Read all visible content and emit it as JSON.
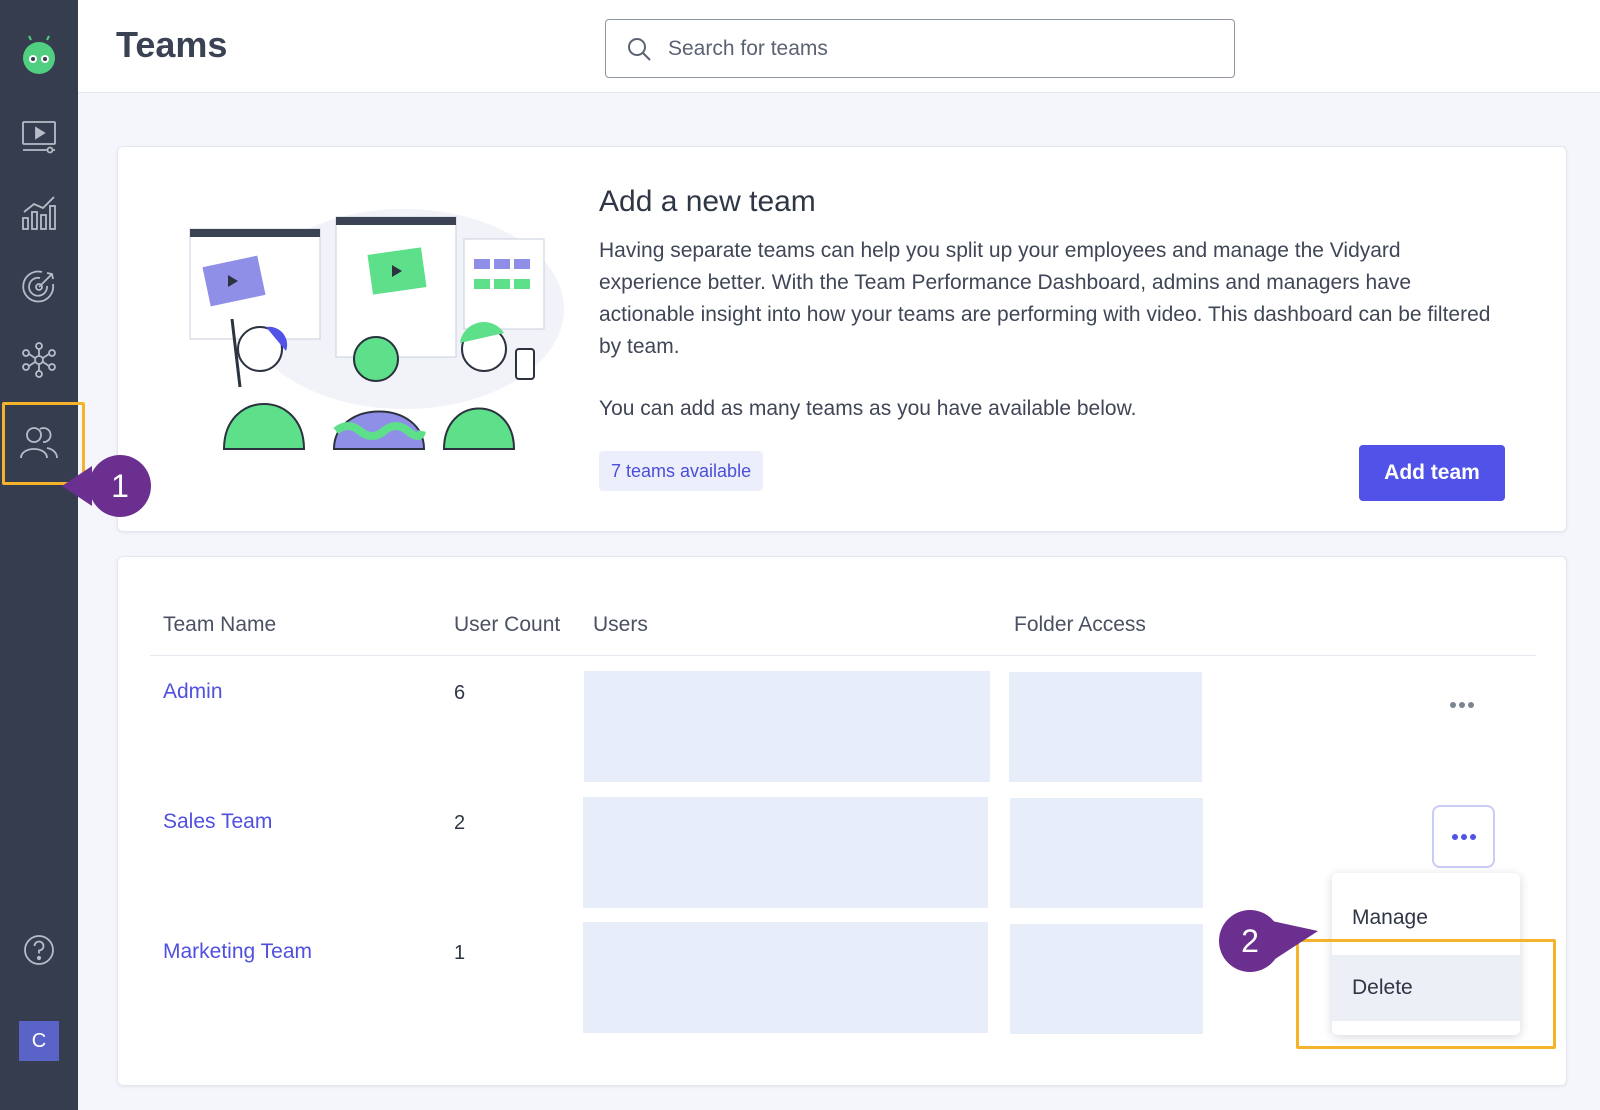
{
  "header": {
    "title": "Teams",
    "search_placeholder": "Search for teams"
  },
  "sidebar": {
    "items": [
      "logo-icon",
      "video-icon",
      "analytics-icon",
      "target-icon",
      "integrations-icon",
      "teams-icon",
      "help-icon"
    ],
    "avatar_initial": "C"
  },
  "add_team_card": {
    "title": "Add a new team",
    "description": "Having separate teams can help you split up your employees and manage the Vidyard experience better. With the Team Performance Dashboard, admins and managers have actionable insight into how your teams are performing with video. This dashboard can be filtered by team.",
    "note": "You can add as many teams as you have available below.",
    "badge": "7 teams available",
    "button_label": "Add team"
  },
  "table": {
    "columns": [
      "Team Name",
      "User Count",
      "Users",
      "Folder Access"
    ],
    "rows": [
      {
        "name": "Admin",
        "count": "6"
      },
      {
        "name": "Sales Team",
        "count": "2"
      },
      {
        "name": "Marketing Team",
        "count": "1"
      }
    ]
  },
  "dropdown": {
    "items": [
      "Manage",
      "Delete"
    ]
  },
  "callouts": [
    "1",
    "2"
  ],
  "colors": {
    "sidebar": "#353d4e",
    "accent": "#5153e8",
    "highlight": "#f4b32a",
    "callout": "#6b2f8f"
  }
}
